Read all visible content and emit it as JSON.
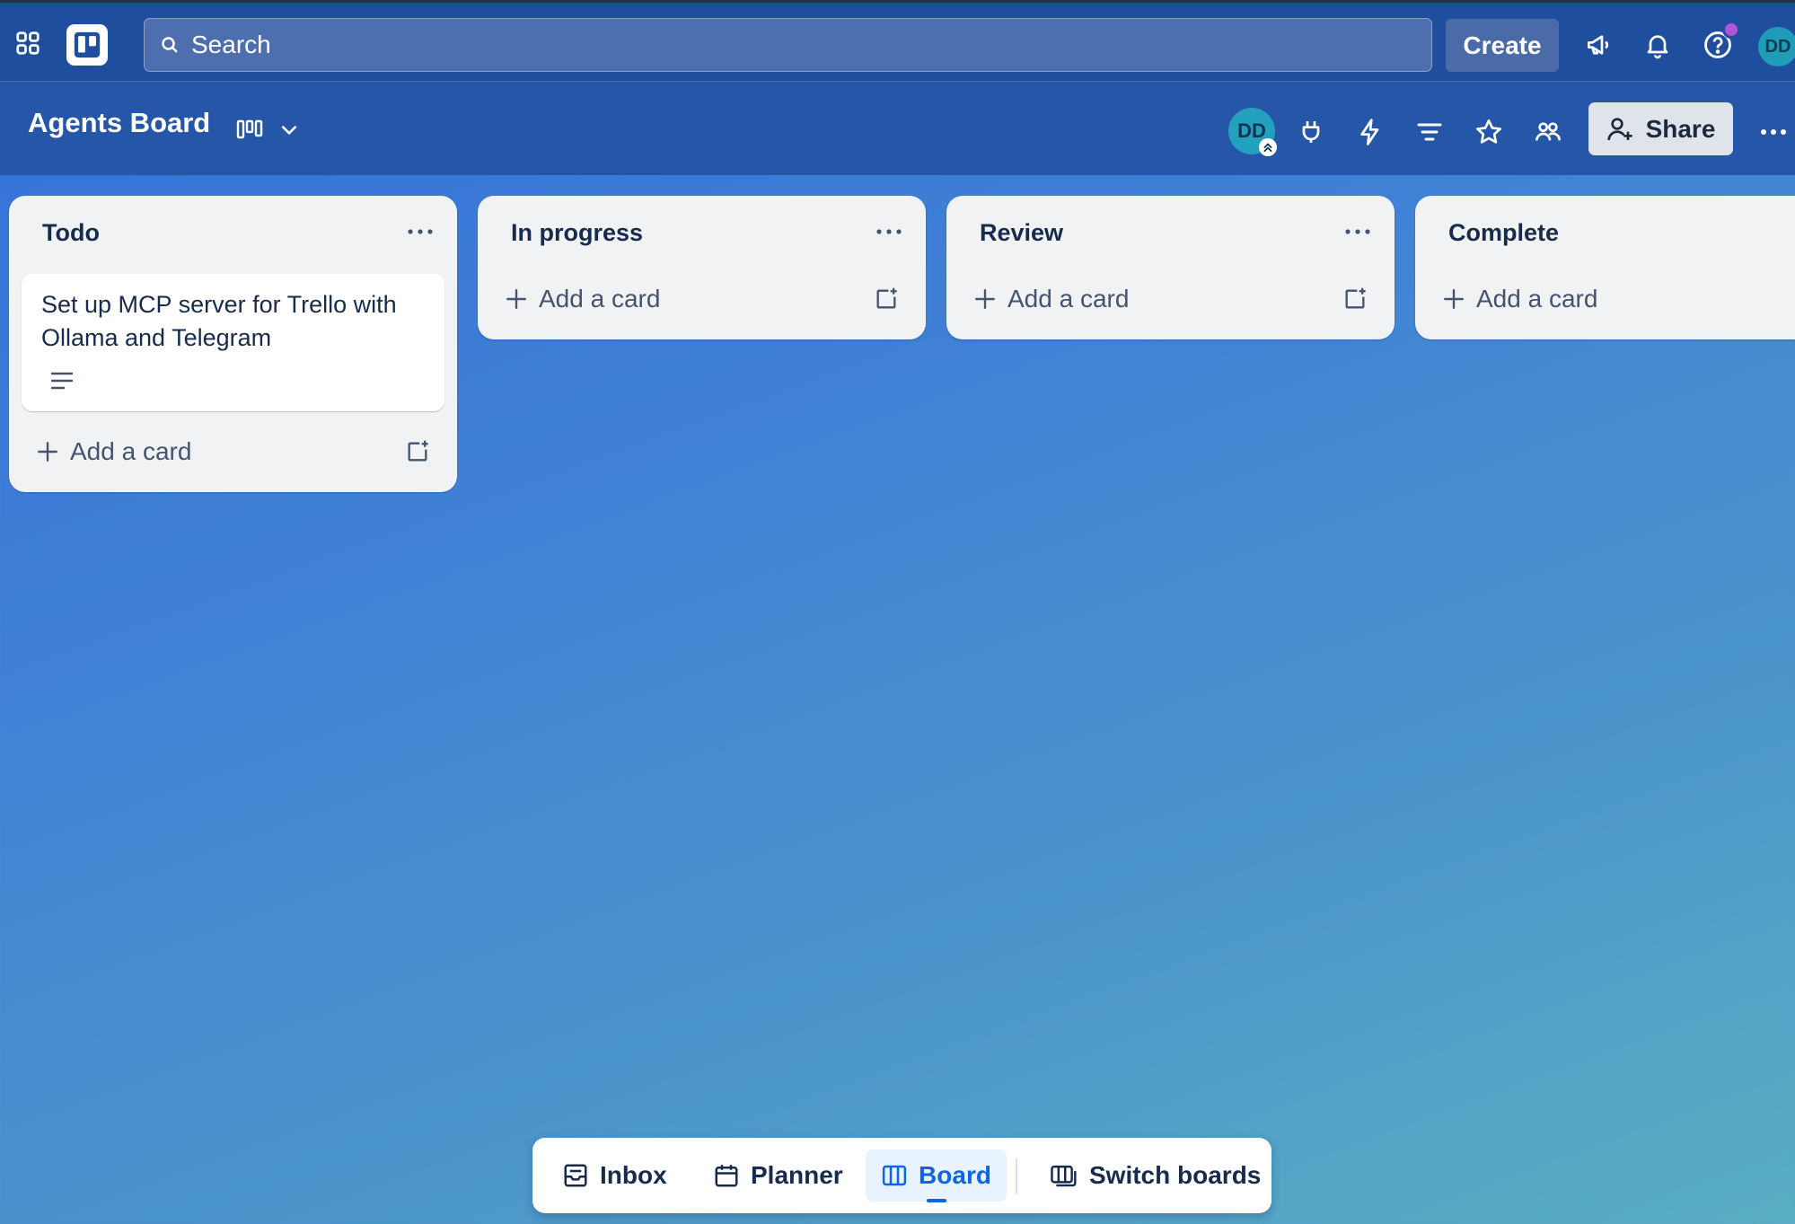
{
  "topbar": {
    "search_placeholder": "Search",
    "create_label": "Create",
    "avatar_initials": "DD"
  },
  "board": {
    "title": "Agents Board",
    "member_initials": "DD",
    "share_label": "Share"
  },
  "lists": [
    {
      "title": "Todo",
      "cards": [
        {
          "title": "Set up MCP server for Trello with Ollama and Telegram",
          "has_description": true
        }
      ],
      "add_card_label": "Add a card"
    },
    {
      "title": "In progress",
      "cards": [],
      "add_card_label": "Add a card"
    },
    {
      "title": "Review",
      "cards": [],
      "add_card_label": "Add a card"
    },
    {
      "title": "Complete",
      "cards": [],
      "add_card_label": "Add a card"
    }
  ],
  "bottom_nav": {
    "items": [
      {
        "label": "Inbox",
        "icon": "inbox-icon",
        "active": false
      },
      {
        "label": "Planner",
        "icon": "calendar-icon",
        "active": false
      },
      {
        "label": "Board",
        "icon": "board-icon",
        "active": true
      },
      {
        "label": "Switch boards",
        "icon": "switch-boards-icon",
        "active": false
      }
    ]
  },
  "colors": {
    "topbar": "#1f4e9f",
    "board_header": "#2556a8",
    "accent": "#0c66e4",
    "list_bg": "#f1f2f4"
  }
}
